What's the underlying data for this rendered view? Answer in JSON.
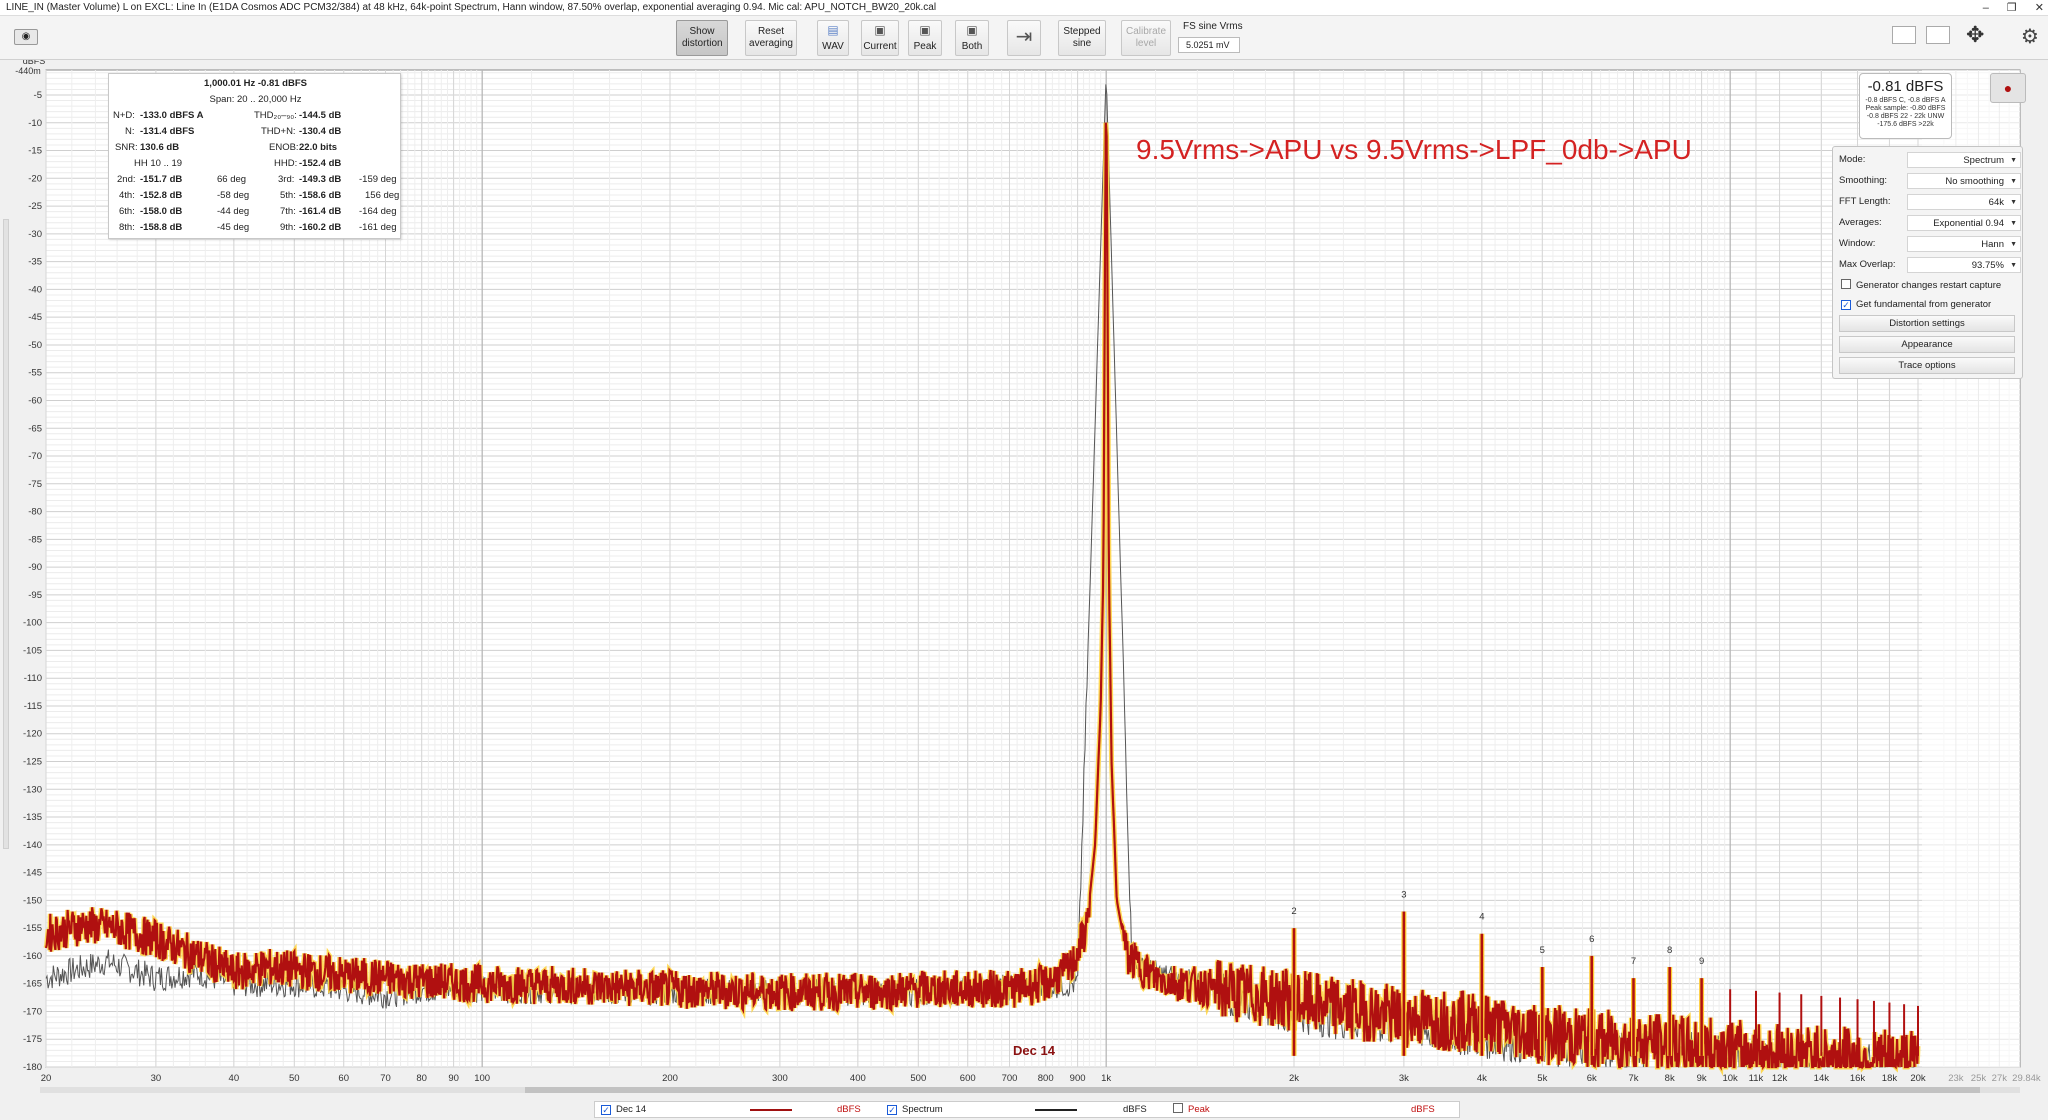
{
  "window": {
    "title": "LINE_IN (Master Volume) L on EXCL: Line In (E1DA Cosmos ADC PCM32/384) at 48 kHz, 64k-point Spectrum, Hann window, 87.50% overlap, exponential averaging 0.94. Mic cal: APU_NOTCH_BW20_20k.cal",
    "controls": [
      "–",
      "❐",
      "✕"
    ]
  },
  "toolbar": {
    "show_distortion": "Show distortion",
    "reset_averaging": "Reset averaging",
    "wav": "WAV",
    "current": "Current",
    "peak": "Peak",
    "both": "Both",
    "stepped_sine": "Stepped sine",
    "calibrate_level": "Calibrate level",
    "fs_label": "FS sine Vrms",
    "fs_value": "5.0251 mV"
  },
  "info": {
    "header": "1,000.01 Hz  -0.81 dBFS",
    "span": "Span: 20 .. 20,000 Hz",
    "nd_label": "N+D:",
    "nd_value": "-133.0 dBFS A",
    "thd_label": "THD₂₀–₉₀:",
    "thd_value": "-144.5 dB",
    "n_label": "N:",
    "n_value": "-131.4 dBFS",
    "thdn_label": "THD+N:",
    "thdn_value": "-130.4 dB",
    "snr_label": "SNR:",
    "snr_value": "130.6 dB",
    "enob_label": "ENOB:",
    "enob_value": "22.0 bits",
    "hh_label": "HH 10 .. 19",
    "hhd_label": "HHD:",
    "hhd_value": "-152.4 dB",
    "harmonics": [
      {
        "l": "2nd:",
        "v": "-151.7 dB",
        "p": "66 deg",
        "l2": "3rd:",
        "v2": "-149.3 dB",
        "p2": "-159 deg"
      },
      {
        "l": "4th:",
        "v": "-152.8 dB",
        "p": "-58 deg",
        "l2": "5th:",
        "v2": "-158.6 dB",
        "p2": "156 deg"
      },
      {
        "l": "6th:",
        "v": "-158.0 dB",
        "p": "-44 deg",
        "l2": "7th:",
        "v2": "-161.4 dB",
        "p2": "-164 deg"
      },
      {
        "l": "8th:",
        "v": "-158.8 dB",
        "p": "-45 deg",
        "l2": "9th:",
        "v2": "-160.2 dB",
        "p2": "-161 deg"
      }
    ]
  },
  "level_meter": {
    "value": "-0.81 dBFS",
    "line1": "-0.8 dBFS C, -0.8 dBFS A",
    "line2": "Peak sample: -0.80 dBFS",
    "line3": "-0.8 dBFS 22 - 22k UNW",
    "line4": "-175.6 dBFS >22k"
  },
  "settings": {
    "mode_label": "Mode:",
    "mode_value": "Spectrum",
    "smoothing_label": "Smoothing:",
    "smoothing_value": "No smoothing",
    "fft_label": "FFT Length:",
    "fft_value": "64k",
    "averages_label": "Averages:",
    "averages_value": "Exponential 0.94",
    "window_label": "Window:",
    "window_value": "Hann",
    "overlap_label": "Max Overlap:",
    "overlap_value": "93.75%",
    "gen_restart": "Generator changes restart capture",
    "gen_restart_checked": false,
    "get_fundamental": "Get fundamental from generator",
    "get_fundamental_checked": true,
    "distortion_settings": "Distortion settings",
    "appearance": "Appearance",
    "trace_options": "Trace options"
  },
  "overlay_title": "9.5Vrms->APU vs 9.5Vrms->LPF_0db->APU",
  "trace_label": "Dec 14",
  "legend": {
    "items": [
      {
        "name": "Dec 14",
        "unit": "dBFS",
        "checked": true,
        "color": "#a01010"
      },
      {
        "name": "Spectrum",
        "unit": "dBFS",
        "checked": true,
        "color": "#222222"
      },
      {
        "name": "Peak",
        "unit": "dBFS",
        "checked": false,
        "color": "#c01010"
      }
    ]
  },
  "chart_data": {
    "type": "line",
    "title": "",
    "xlabel": "",
    "ylabel": "dBFS",
    "x_scale": "log",
    "xlim": [
      20,
      30000
    ],
    "ylim": [
      -180,
      -0.5
    ],
    "y_top_label": "-440m",
    "y_ticks": [
      -5,
      -10,
      -15,
      -20,
      -25,
      -30,
      -35,
      -40,
      -45,
      -50,
      -55,
      -60,
      -65,
      -70,
      -75,
      -80,
      -85,
      -90,
      -95,
      -100,
      -105,
      -110,
      -115,
      -120,
      -125,
      -130,
      -135,
      -140,
      -145,
      -150,
      -155,
      -160,
      -165,
      -170,
      -175,
      -180
    ],
    "x_ticks": [
      {
        "v": 20,
        "t": "20"
      },
      {
        "v": 30,
        "t": "30"
      },
      {
        "v": 40,
        "t": "40"
      },
      {
        "v": 50,
        "t": "50"
      },
      {
        "v": 60,
        "t": "60"
      },
      {
        "v": 70,
        "t": "70"
      },
      {
        "v": 80,
        "t": "80"
      },
      {
        "v": 90,
        "t": "90"
      },
      {
        "v": 100,
        "t": "100"
      },
      {
        "v": 200,
        "t": "200"
      },
      {
        "v": 300,
        "t": "300"
      },
      {
        "v": 400,
        "t": "400"
      },
      {
        "v": 500,
        "t": "500"
      },
      {
        "v": 600,
        "t": "600"
      },
      {
        "v": 700,
        "t": "700"
      },
      {
        "v": 800,
        "t": "800"
      },
      {
        "v": 900,
        "t": "900"
      },
      {
        "v": 1000,
        "t": "1k"
      },
      {
        "v": 2000,
        "t": "2k"
      },
      {
        "v": 3000,
        "t": "3k"
      },
      {
        "v": 4000,
        "t": "4k"
      },
      {
        "v": 5000,
        "t": "5k"
      },
      {
        "v": 6000,
        "t": "6k"
      },
      {
        "v": 7000,
        "t": "7k"
      },
      {
        "v": 8000,
        "t": "8k"
      },
      {
        "v": 9000,
        "t": "9k"
      },
      {
        "v": 10000,
        "t": "10k"
      },
      {
        "v": 11000,
        "t": "11k"
      },
      {
        "v": 12000,
        "t": "12k"
      },
      {
        "v": 14000,
        "t": "14k"
      },
      {
        "v": 16000,
        "t": "16k"
      },
      {
        "v": 18000,
        "t": "18k"
      },
      {
        "v": 20000,
        "t": "20k"
      },
      {
        "v": 23000,
        "t": "23k"
      },
      {
        "v": 25000,
        "t": "25k"
      },
      {
        "v": 27000,
        "t": "27k"
      },
      {
        "v": 29840,
        "t": "29.84k"
      }
    ],
    "series": [
      {
        "name": "Dec 14",
        "color": "#b01010",
        "x": [
          20,
          23,
          26,
          30,
          35,
          40,
          45,
          50,
          60,
          70,
          80,
          100,
          150,
          200,
          300,
          400,
          500,
          600,
          700,
          800,
          880,
          930,
          960,
          980,
          990,
          995,
          1000,
          1005,
          1010,
          1020,
          1040,
          1080,
          1200,
          1500,
          2000,
          3000,
          4000,
          5000,
          6000,
          8000,
          10000,
          14000,
          20000
        ],
        "y": [
          -156,
          -154.5,
          -155,
          -157,
          -160,
          -163,
          -162,
          -162.5,
          -163.5,
          -164,
          -164.5,
          -165,
          -165.5,
          -166,
          -166.5,
          -166.5,
          -166,
          -166,
          -166,
          -165,
          -162,
          -155,
          -140,
          -115,
          -90,
          -40,
          -0.81,
          -40,
          -90,
          -125,
          -150,
          -160,
          -164,
          -166,
          -168,
          -171,
          -172,
          -174,
          -175,
          -176,
          -177,
          -178,
          -179
        ]
      },
      {
        "name": "Spectrum",
        "color": "#555555",
        "x": [
          20,
          25,
          30,
          35,
          40,
          50,
          60,
          70,
          80,
          100,
          200,
          500,
          900,
          1000,
          1100,
          2000,
          5000,
          10000,
          20000
        ],
        "y": [
          -164,
          -161,
          -164,
          -163,
          -165,
          -165,
          -166,
          -167,
          -166,
          -166,
          -166.5,
          -166.5,
          -165,
          -0.81,
          -162,
          -170,
          -176,
          -178,
          -180
        ]
      }
    ],
    "harmonic_markers": [
      {
        "label": "2",
        "x": 2000,
        "y": -155
      },
      {
        "label": "3",
        "x": 3000,
        "y": -152
      },
      {
        "label": "4",
        "x": 4000,
        "y": -156
      },
      {
        "label": "5",
        "x": 5000,
        "y": -162
      },
      {
        "label": "6",
        "x": 6000,
        "y": -160
      },
      {
        "label": "7",
        "x": 7000,
        "y": -164
      },
      {
        "label": "8",
        "x": 8000,
        "y": -162
      },
      {
        "label": "9",
        "x": 9000,
        "y": -164
      }
    ],
    "grid": true
  }
}
